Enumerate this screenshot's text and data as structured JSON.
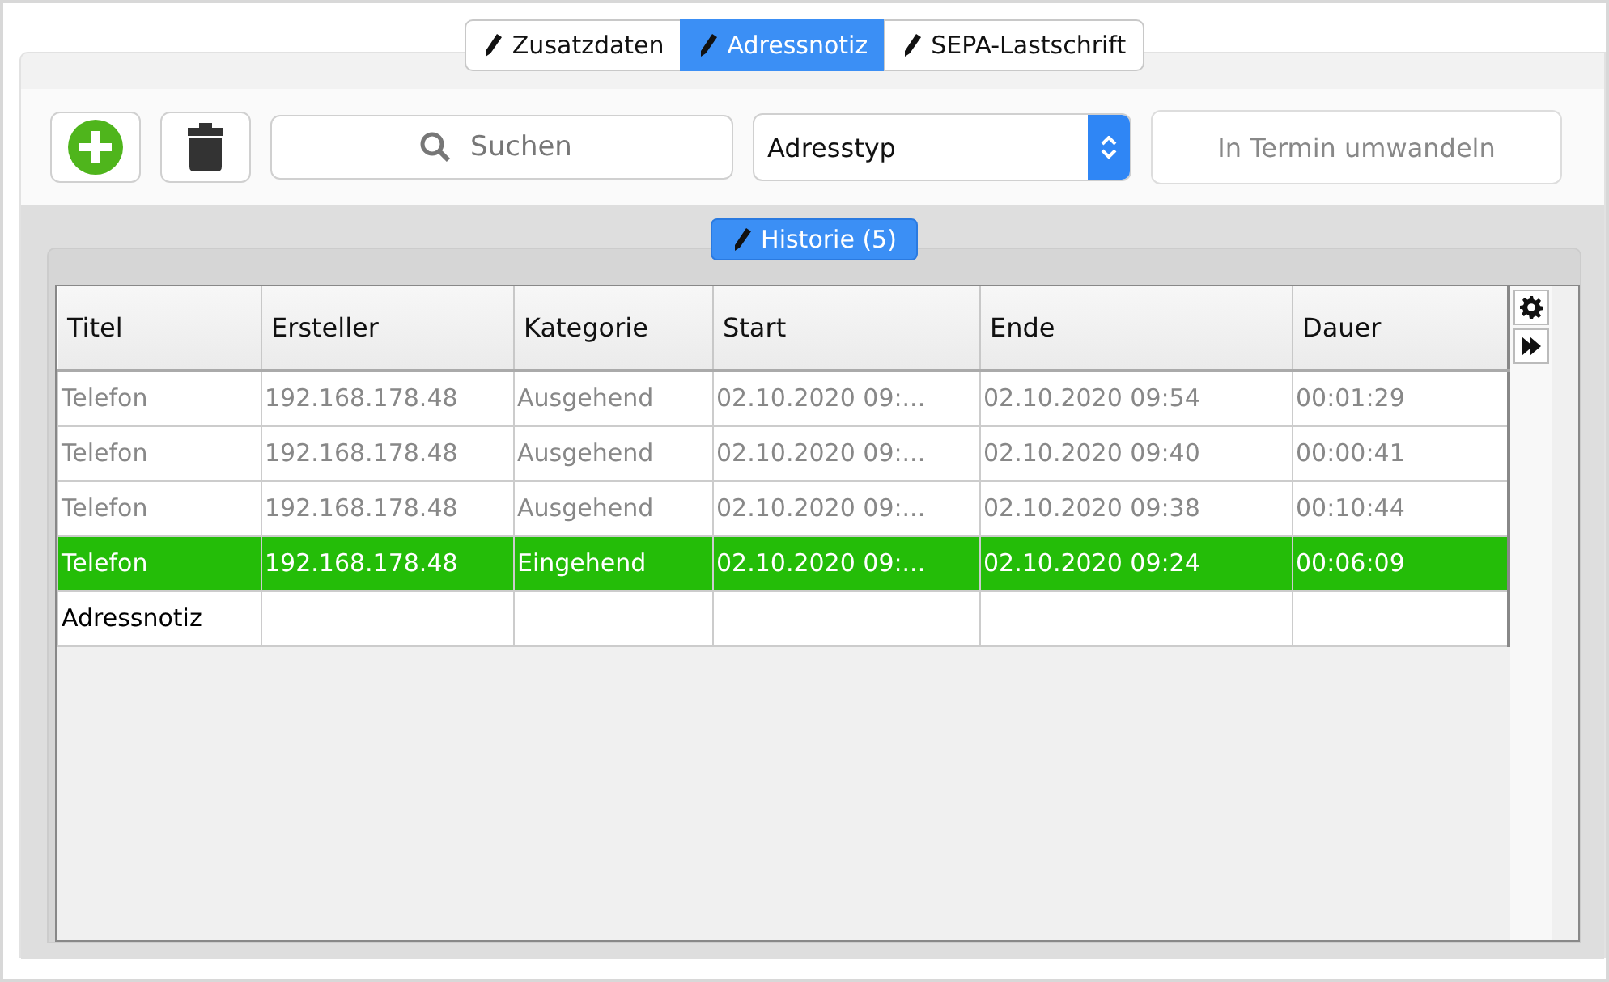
{
  "tabs": [
    {
      "label": "Zusatzdaten",
      "selected": false
    },
    {
      "label": "Adressnotiz",
      "selected": true
    },
    {
      "label": "SEPA-Lastschrift",
      "selected": false
    }
  ],
  "toolbar": {
    "search": {
      "placeholder": "Suchen"
    },
    "address_type": {
      "value": "Adresstyp"
    },
    "convert_button": {
      "label": "In Termin umwandeln",
      "disabled": true
    }
  },
  "history_tab": {
    "label": "Historie (5)",
    "selected": true
  },
  "table": {
    "columns": [
      "Titel",
      "Ersteller",
      "Kategorie",
      "Start",
      "Ende",
      "Dauer"
    ],
    "rows": [
      {
        "cells": [
          "Telefon",
          "192.168.178.48",
          "Ausgehend",
          "02.10.2020 09:...",
          "02.10.2020 09:54",
          "00:01:29"
        ],
        "selected": false,
        "dimmed": true
      },
      {
        "cells": [
          "Telefon",
          "192.168.178.48",
          "Ausgehend",
          "02.10.2020 09:...",
          "02.10.2020 09:40",
          "00:00:41"
        ],
        "selected": false,
        "dimmed": true
      },
      {
        "cells": [
          "Telefon",
          "192.168.178.48",
          "Ausgehend",
          "02.10.2020 09:...",
          "02.10.2020 09:38",
          "00:10:44"
        ],
        "selected": false,
        "dimmed": true
      },
      {
        "cells": [
          "Telefon",
          "192.168.178.48",
          "Eingehend",
          "02.10.2020 09:...",
          "02.10.2020 09:24",
          "00:06:09"
        ],
        "selected": true,
        "dimmed": false
      },
      {
        "cells": [
          "Adressnotiz",
          "",
          "",
          "",
          "",
          ""
        ],
        "selected": false,
        "dimmed": false
      }
    ]
  }
}
